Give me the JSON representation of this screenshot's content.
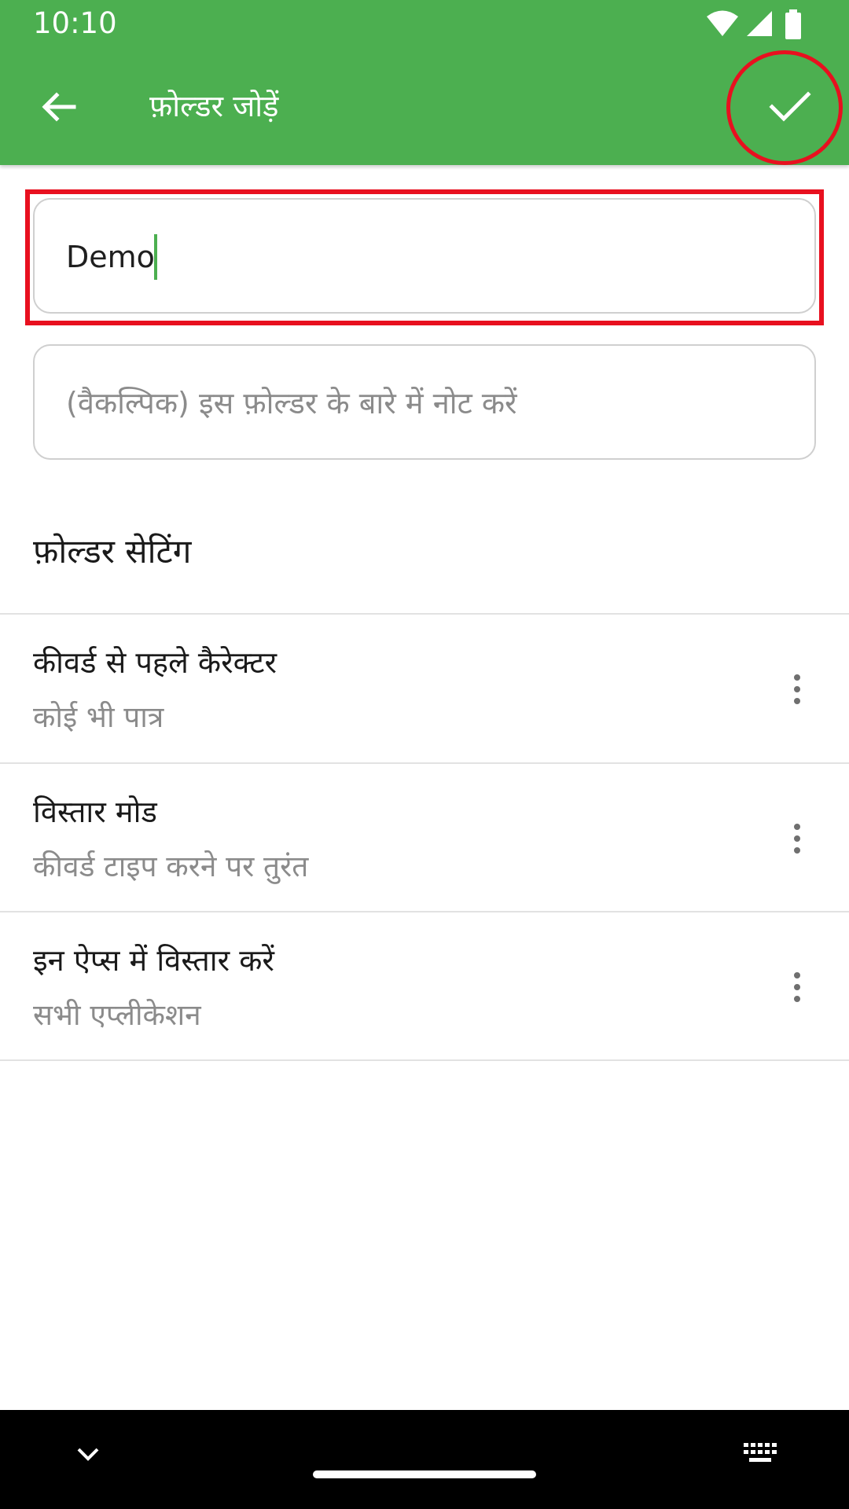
{
  "status_bar": {
    "time": "10:10",
    "icons": [
      "wifi-icon",
      "cellular-signal-icon",
      "battery-icon"
    ]
  },
  "toolbar": {
    "back_icon": "arrow-back-icon",
    "title": "फ़ोल्डर जोड़ें",
    "confirm_icon": "checkmark-icon"
  },
  "form": {
    "name_value": "Demo",
    "note_placeholder": "(वैकल्पिक) इस फ़ोल्डर के बारे में नोट करें"
  },
  "settings": {
    "header": "फ़ोल्डर सेटिंग",
    "items": [
      {
        "title": "कीवर्ड से पहले कैरेक्टर",
        "value": "कोई भी पात्र"
      },
      {
        "title": "विस्तार मोड",
        "value": "कीवर्ड टाइप करने पर तुरंत"
      },
      {
        "title": "इन ऐप्स में विस्तार करें",
        "value": "सभी एप्लीकेशन"
      }
    ]
  },
  "navigation_bar": {
    "icons": [
      "chevron-down-icon",
      "home-handle",
      "keyboard-icon"
    ]
  },
  "colors": {
    "primary": "#4caf50",
    "highlight": "#e8101f",
    "secondary_text": "#8b8b8b"
  }
}
